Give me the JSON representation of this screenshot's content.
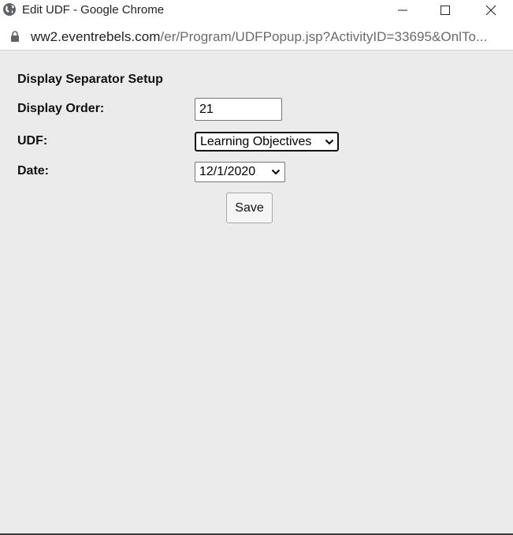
{
  "window": {
    "title": "Edit UDF - Google Chrome",
    "controls": {
      "minimize_icon": "minimize-icon",
      "maximize_icon": "maximize-icon",
      "close_icon": "close-icon"
    }
  },
  "addressbar": {
    "host": "ww2.eventrebels.com",
    "path": "/er/Program/UDFPopup.jsp?ActivityID=33695&OnlTo..."
  },
  "form": {
    "heading": "Display Separator Setup",
    "display_order": {
      "label": "Display Order:",
      "value": "21"
    },
    "udf": {
      "label": "UDF:",
      "selected": "Learning Objectives"
    },
    "date": {
      "label": "Date:",
      "selected": "12/1/2020"
    },
    "save_label": "Save"
  },
  "colors": {
    "page_background": "#ebebeb",
    "chrome_background": "#ffffff",
    "url_path": "#6a6a6a"
  }
}
